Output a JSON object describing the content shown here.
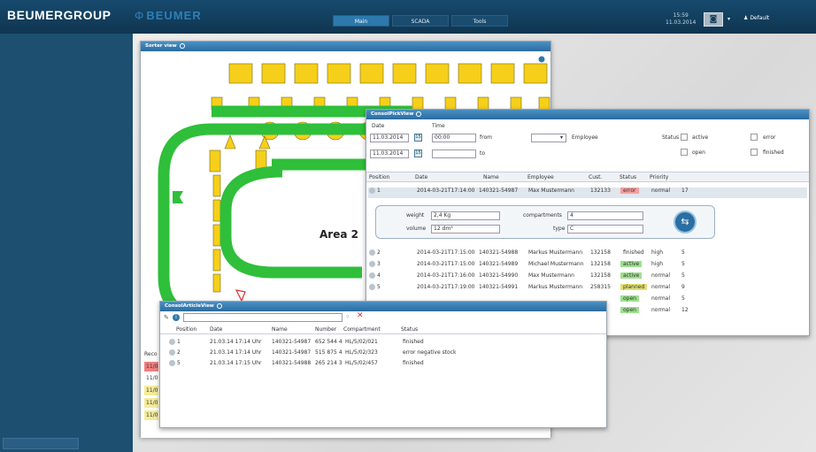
{
  "header": {
    "brand_logo_text": "BEUMERGROUP",
    "brand_secondary_text": "BEUMER",
    "tabs": [
      {
        "label": "Main",
        "active": true
      },
      {
        "label": "SCADA",
        "active": false
      },
      {
        "label": "Tools",
        "active": false
      }
    ],
    "clock_time": "15:59",
    "clock_date": "11.03.2014",
    "user_label": "Default"
  },
  "sorter_view": {
    "title": "Sorter view",
    "area_label": "Area 2"
  },
  "consol_pick_view": {
    "title": "ConsolPickView",
    "date_label": "Date",
    "time_label": "Time",
    "date_from": "11.03.2014",
    "time_from": "00:00",
    "date_to": "11.03.2014",
    "time_to": "",
    "from_label": "from",
    "to_label": "to",
    "employee_label": "Employee",
    "status_label": "Status",
    "checkboxes": [
      "active",
      "open",
      "error",
      "finished"
    ],
    "columns": [
      "Position",
      "Date",
      "Name",
      "Employee",
      "Cust.",
      "Status",
      "Priority"
    ],
    "rows": [
      {
        "pos": "1",
        "date": "2014-03-21T17:14:00",
        "name": "140321-54987",
        "employee": "Max Mustermann",
        "cust": "132133",
        "status": "error",
        "priority": "normal",
        "extra": "17",
        "color": "#f2a0a0"
      },
      {
        "pos": "2",
        "date": "2014-03-21T17:15:00",
        "name": "140321-54988",
        "employee": "Markus Mustermann",
        "cust": "132158",
        "status": "finished",
        "priority": "high",
        "extra": "5",
        "color": ""
      },
      {
        "pos": "3",
        "date": "2014-03-21T17:15:00",
        "name": "140321-54989",
        "employee": "Michael Mustermann",
        "cust": "132158",
        "status": "active",
        "priority": "high",
        "extra": "5",
        "color": "#9ee08f"
      },
      {
        "pos": "4",
        "date": "2014-03-21T17:16:00",
        "name": "140321-54990",
        "employee": "Max Mustermann",
        "cust": "132158",
        "status": "active",
        "priority": "normal",
        "extra": "5",
        "color": "#9ee08f"
      },
      {
        "pos": "5",
        "date": "2014-03-21T17:19:00",
        "name": "140321-54991",
        "employee": "Markus Mustermann",
        "cust": "258315",
        "status": "planned",
        "priority": "normal",
        "extra": "9",
        "color": "#e2e070"
      },
      {
        "pos": "",
        "date": "",
        "name": "",
        "employee": "",
        "cust": "",
        "status": "open",
        "priority": "normal",
        "extra": "5",
        "color": "#9ee08f"
      },
      {
        "pos": "",
        "date": "",
        "name": "",
        "employee": "",
        "cust": "",
        "status": "open",
        "priority": "normal",
        "extra": "12",
        "color": "#9ee08f"
      }
    ],
    "detail": {
      "weight_label": "weight",
      "weight_value": "2,4 Kg",
      "volume_label": "volume",
      "volume_value": "12 dm³",
      "compartments_label": "compartments",
      "compartments_value": "4",
      "type_label": "type",
      "type_value": "C"
    }
  },
  "consol_article_view": {
    "title": "ConsolArticleView",
    "columns": [
      "Position",
      "Date",
      "Name",
      "Number",
      "Compartment",
      "Status"
    ],
    "rows": [
      {
        "pos": "1",
        "date": "21.03.14 17:14 Uhr",
        "name": "140321-54987",
        "number": "652 544 4",
        "compartment": "HL/5/02/021",
        "status": "finished"
      },
      {
        "pos": "2",
        "date": "21.03.14 17:14 Uhr",
        "name": "140321-54987",
        "number": "515 875 4",
        "compartment": "HL/5/02/323",
        "status": "error negative stock"
      },
      {
        "pos": "5",
        "date": "21.03.14 17:15 Uhr",
        "name": "140321-54988",
        "number": "265 214 3",
        "compartment": "HL/5/02/457",
        "status": "finished"
      }
    ]
  },
  "background_list": {
    "header": "Reco",
    "rows": [
      "11/0",
      "11/0",
      "11/0",
      "11/0",
      "11/0"
    ]
  },
  "colors": {
    "accent": "#2d79ad",
    "conveyor_green": "#2fbf3a",
    "bin_yellow": "#f6cf1a",
    "error": "#f2a0a0",
    "active": "#9ee08f",
    "planned": "#e2e070"
  }
}
